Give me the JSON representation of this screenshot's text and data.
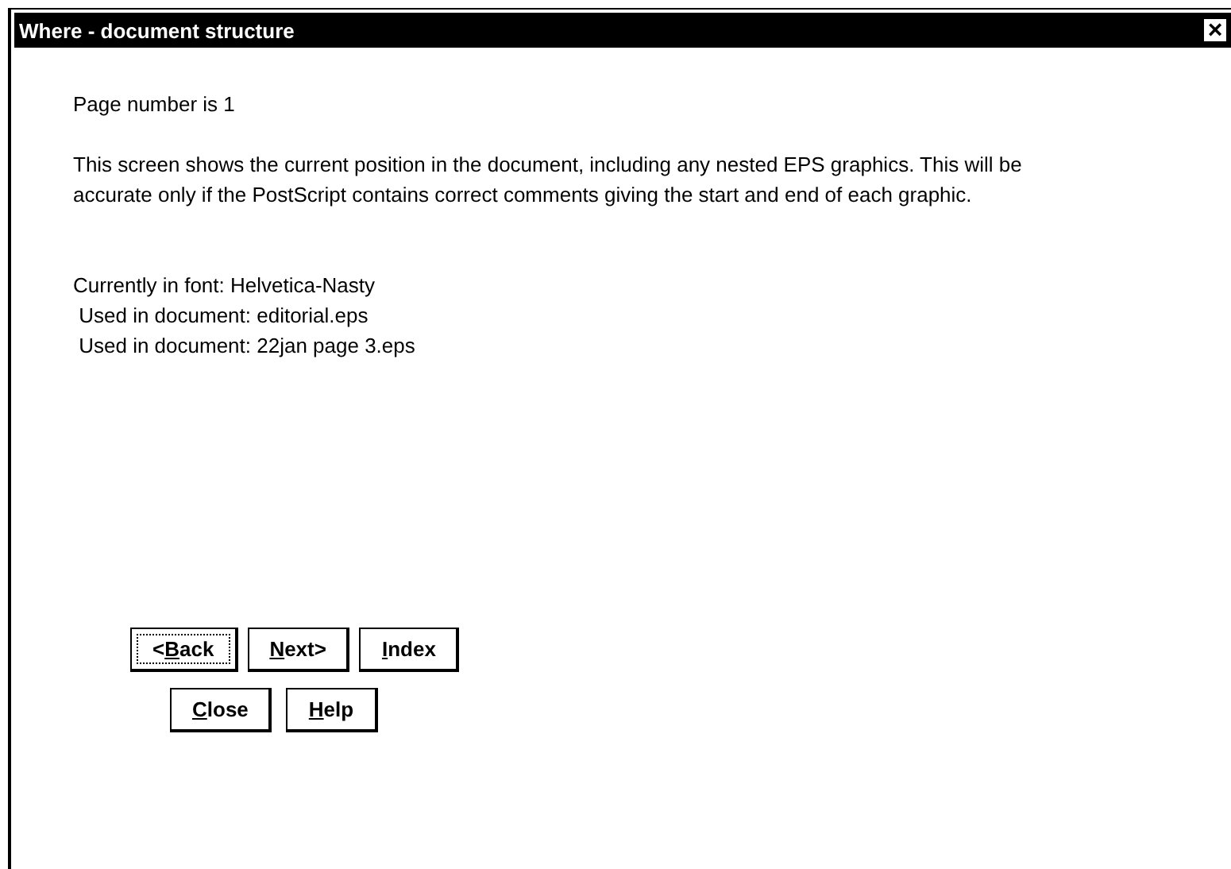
{
  "window": {
    "title": "Where - document structure",
    "close": "×"
  },
  "page_number": "Page number is 1",
  "description": "This screen shows the current position in the document, including any nested EPS graphics. This will be accurate only if the PostScript contains correct comments giving the start and end of each graphic.",
  "font_info": [
    "Currently in font: Helvetica-Nasty",
    " Used in document: editorial.eps",
    " Used in document: 22jan page 3.eps"
  ],
  "button_rows": [
    [
      {
        "before_key": "<",
        "access_key": "B",
        "after_key": "ack",
        "focused": true
      },
      {
        "access_key": "N",
        "after_key": "ext>",
        "focused": false
      },
      {
        "access_key": "I",
        "after_key": "ndex",
        "focused": false
      }
    ],
    [
      {
        "access_key": "C",
        "after_key": "lose",
        "focused": false
      },
      {
        "access_key": "H",
        "after_key": "elp",
        "focused": false
      }
    ]
  ]
}
